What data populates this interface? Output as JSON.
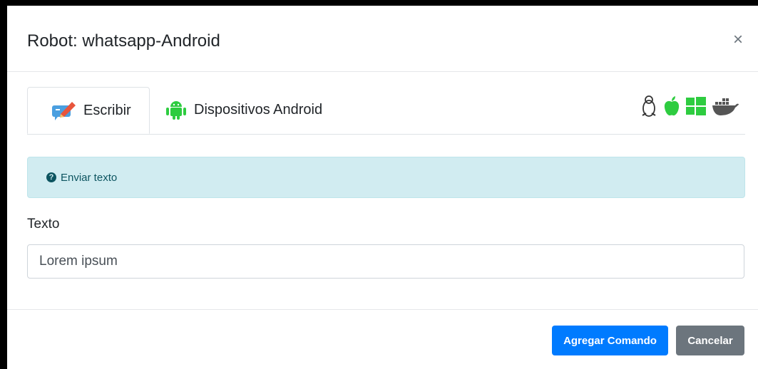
{
  "modal": {
    "title": "Robot: whatsapp-Android",
    "close_symbol": "×"
  },
  "tabs": [
    {
      "label": "Escribir",
      "icon": "pencil-edit-icon",
      "active": true
    },
    {
      "label": "Dispositivos Android",
      "icon": "android-icon",
      "active": false
    }
  ],
  "os_icons": [
    "linux-icon",
    "apple-icon",
    "windows-icon",
    "docker-icon"
  ],
  "alert": {
    "icon": "question-circle-icon",
    "text": "Enviar texto"
  },
  "form": {
    "label": "Texto",
    "value": "Lorem ipsum"
  },
  "footer": {
    "primary_label": "Agregar Comando",
    "secondary_label": "Cancelar"
  },
  "colors": {
    "primary": "#007bff",
    "secondary": "#6c757d",
    "info_bg": "#d1ecf1",
    "android_green": "#3ddc84"
  }
}
